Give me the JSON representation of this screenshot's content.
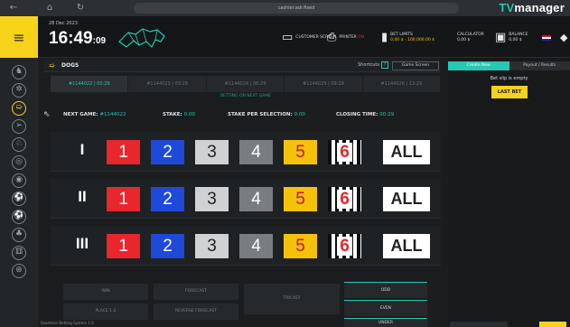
{
  "browser": {
    "address": "cashier.adr.fixed",
    "brand_tv": "TV",
    "brand_rest": "manager"
  },
  "topbar": {
    "date": "28 Dec 2023",
    "time_main": "16:49",
    "time_sec": ":09",
    "customer_screen_label": "CUSTOMER SCREEN",
    "printer_label": "PRINTER",
    "printer_state": "ON",
    "bet_limits_label": "BET LIMITS",
    "bet_limits_value": "0,00 $ - 100,000.00 $",
    "calculator_label": "CALCULATOR",
    "calculator_value": "0,00 $",
    "balance_label": "BALANCE",
    "balance_value": "0,00 $"
  },
  "game": {
    "title": "DOGS",
    "shortcuts_label": "Shortcuts",
    "shortcuts_key": "?",
    "game_screen_label": "Game Screen",
    "tabs": [
      "#1144022 | 00:29",
      "#1144023 | 03:29",
      "#1144024 | 06:29",
      "#1144025 | 09:29",
      "#1144026 | 12:29"
    ],
    "bet_notice": "BETTING ON NEXT GAME",
    "next_game_label": "NEXT GAME:",
    "next_game_value": "#1144022",
    "stake_label": "STAKE:",
    "stake_value": "0.00",
    "stake_per_selection_label": "STAKE PER SELECTION:",
    "stake_per_selection_value": "0.00",
    "closing_time_label": "CLOSING TIME:",
    "closing_time_value": "00:29"
  },
  "bet_rows": [
    {
      "roman": "I",
      "nums": [
        "1",
        "2",
        "3",
        "4",
        "5",
        "6"
      ],
      "all": "ALL"
    },
    {
      "roman": "II",
      "nums": [
        "1",
        "2",
        "3",
        "4",
        "5",
        "6"
      ],
      "all": "ALL"
    },
    {
      "roman": "III",
      "nums": [
        "1",
        "2",
        "3",
        "4",
        "5",
        "6"
      ],
      "all": "ALL"
    }
  ],
  "bet_types": {
    "win": "WIN",
    "forecast": "FORECAST",
    "tricast": "TRICAST",
    "place": "PLACE 1-2",
    "reverse_forecast": "REVERSE FORECAST",
    "odd": "ODD",
    "even": "EVEN",
    "under": "UNDER"
  },
  "footer": {
    "text": "Seamless Betting System 1.0"
  },
  "right_panel": {
    "tab_ticket": "Create New",
    "tab_results": "Payout / Results",
    "slip_empty": "Bet slip is empty",
    "last_bet": "LAST BET"
  },
  "colors": {
    "accent": "#27c7b3",
    "yellow": "#f7d21b",
    "red": "#e8262b",
    "blue": "#1f49d8"
  }
}
